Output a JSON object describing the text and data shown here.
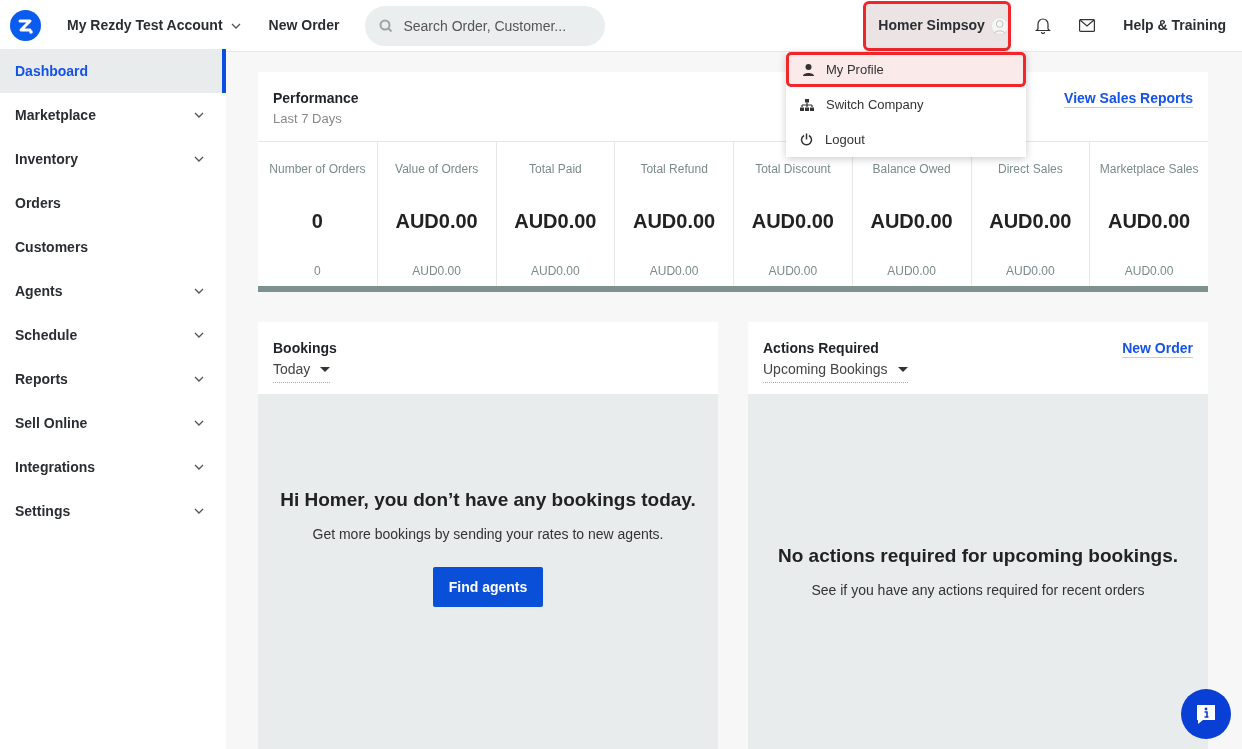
{
  "topbar": {
    "account": "My Rezdy Test Account",
    "new_order": "New Order",
    "search": {
      "placeholder": "Search Order, Customer..."
    },
    "user": {
      "name": "Homer Simpsoy",
      "highlighted": true
    },
    "help": "Help & Training"
  },
  "user_menu": {
    "expanded": true,
    "items": [
      {
        "label": "My Profile",
        "highlighted": true
      },
      {
        "label": "Switch Company",
        "highlighted": false
      },
      {
        "label": "Logout",
        "highlighted": false
      }
    ]
  },
  "sidebar": {
    "items": [
      {
        "label": "Dashboard",
        "selected": true,
        "has_submenu": false
      },
      {
        "label": "Marketplace",
        "selected": false,
        "has_submenu": true
      },
      {
        "label": "Inventory",
        "selected": false,
        "has_submenu": true
      },
      {
        "label": "Orders",
        "selected": false,
        "has_submenu": false
      },
      {
        "label": "Customers",
        "selected": false,
        "has_submenu": false
      },
      {
        "label": "Agents",
        "selected": false,
        "has_submenu": true
      },
      {
        "label": "Schedule",
        "selected": false,
        "has_submenu": true
      },
      {
        "label": "Reports",
        "selected": false,
        "has_submenu": true
      },
      {
        "label": "Sell Online",
        "selected": false,
        "has_submenu": true
      },
      {
        "label": "Integrations",
        "selected": false,
        "has_submenu": true
      },
      {
        "label": "Settings",
        "selected": false,
        "has_submenu": true
      }
    ]
  },
  "performance": {
    "title": "Performance",
    "subtitle": "Last 7 Days",
    "link": "View Sales Reports",
    "metrics": [
      {
        "label": "Number of Orders",
        "value": "0",
        "sub": "0"
      },
      {
        "label": "Value of Orders",
        "value": "AUD0.00",
        "sub": "AUD0.00"
      },
      {
        "label": "Total Paid",
        "value": "AUD0.00",
        "sub": "AUD0.00"
      },
      {
        "label": "Total Refund",
        "value": "AUD0.00",
        "sub": "AUD0.00"
      },
      {
        "label": "Total Discount",
        "value": "AUD0.00",
        "sub": "AUD0.00"
      },
      {
        "label": "Balance Owed",
        "value": "AUD0.00",
        "sub": "AUD0.00"
      },
      {
        "label": "Direct Sales",
        "value": "AUD0.00",
        "sub": "AUD0.00"
      },
      {
        "label": "Marketplace Sales",
        "value": "AUD0.00",
        "sub": "AUD0.00"
      }
    ]
  },
  "bookings": {
    "title": "Bookings",
    "filter": "Today",
    "heading": "Hi Homer, you don’t have any bookings today.",
    "text": "Get more bookings by sending your rates to new agents.",
    "button": "Find agents"
  },
  "actions": {
    "title": "Actions Required",
    "filter": "Upcoming Bookings",
    "link": "New Order",
    "heading": "No actions required for upcoming bookings.",
    "text": "See if you have any actions required for recent orders"
  }
}
